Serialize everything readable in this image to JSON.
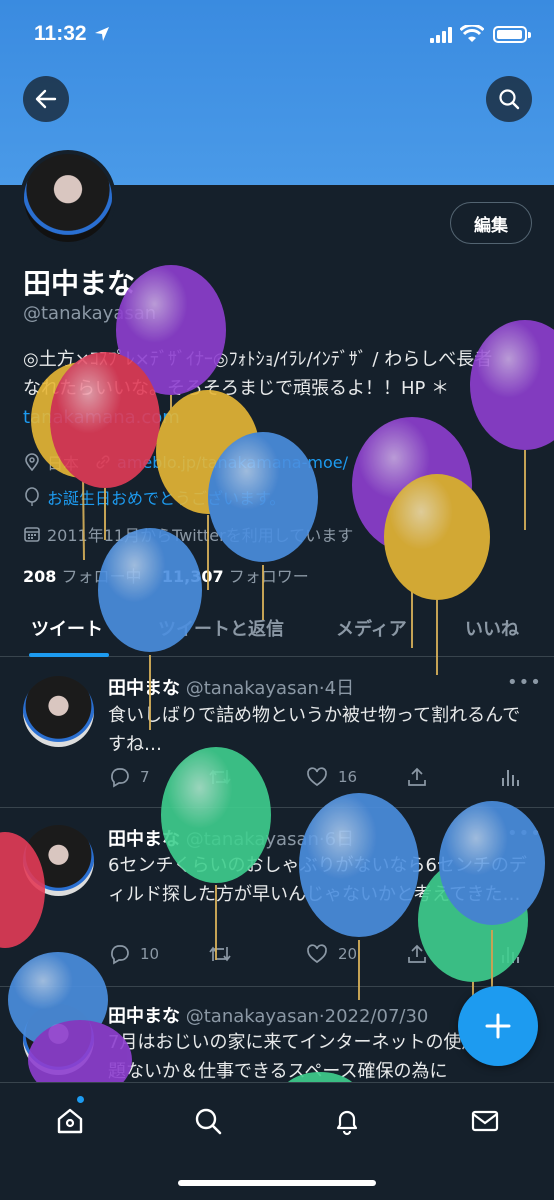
{
  "status_bar": {
    "time": "11:32"
  },
  "colors": {
    "accent": "#1d9bf0",
    "background": "#15202b",
    "banner": "#3a8be0",
    "muted": "#8b98a5"
  },
  "header": {
    "back_icon": "arrow-left-icon",
    "search_icon": "search-icon"
  },
  "profile": {
    "edit_label": "編集",
    "name": "田中まな",
    "handle": "@tanakayasan",
    "bio_line1": "◎土方×ｺｽﾌﾟﾚ×ﾃﾞｻﾞｲﾅｰ◎ﾌｫﾄｼｮ/ｲﾗﾚ/ｲﾝﾃﾞｻﾞ / わらしべ長者",
    "bio_line2": "なれたらいいな。そろそろまじで頑張るよ！！HP ＊",
    "bio_line3": "tanakamana.com",
    "location": "日本",
    "website": "ameblo.jp/tanakamana-moe/",
    "birthday": "お誕生日おめでとうございます。",
    "joined": "2011年11月からTwitterを利用しています",
    "following_count": "208",
    "following_label": "フォロー中",
    "followers_count": "11,307",
    "followers_label": "フォロワー"
  },
  "tabs": [
    "ツイート",
    "ツイートと返信",
    "メディア",
    "いいね"
  ],
  "tweets": [
    {
      "name": "田中まな",
      "handle": "@tanakayasan",
      "time": "4日",
      "text": "食いしばりで詰め物というか被せ物って割れるんですね…",
      "replies": "7",
      "retweets": "",
      "likes": "16"
    },
    {
      "name": "田中まな",
      "handle": "@tanakayasan",
      "time": "6日",
      "text": "6センチくらいのおしゃぶりがないなら6センチのディルド探した方が早いんじゃないかと考えてきた…",
      "replies": "10",
      "retweets": "",
      "likes": "20"
    },
    {
      "name": "田中まな",
      "handle": "@tanakayasan",
      "time": "2022/07/30",
      "text": "7月はおじいの家に来てインターネットの使用に問題ないか＆仕事できるスペース確保の為に"
    }
  ],
  "more_glyph": "•••",
  "bottom_nav": [
    "home-icon",
    "search-icon",
    "bell-icon",
    "mail-icon"
  ]
}
